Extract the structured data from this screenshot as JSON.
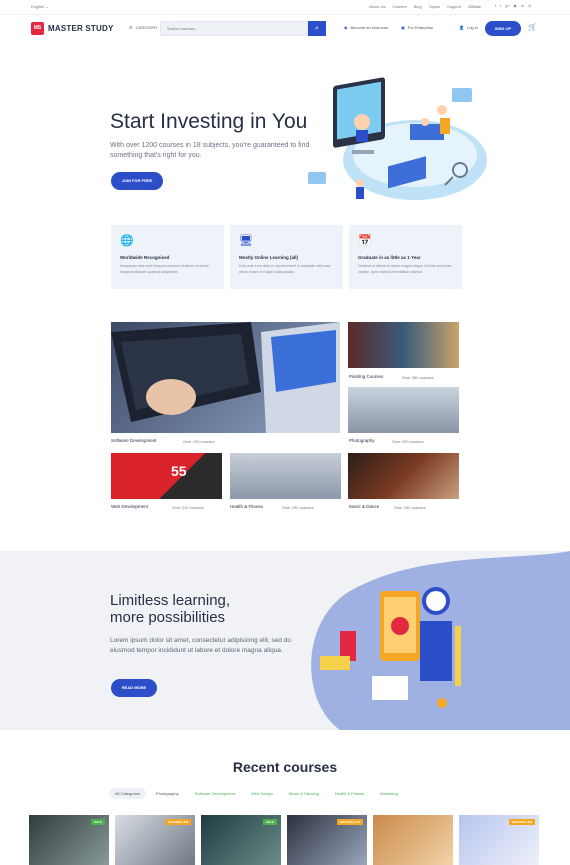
{
  "topbar": {
    "language": "English ⌄",
    "links": [
      "About Us",
      "Careers",
      "Blog",
      "Topics",
      "Support",
      "Affiliate"
    ],
    "socials": [
      "f",
      "t",
      "g+",
      "▶",
      "in",
      "◎"
    ]
  },
  "header": {
    "logo_mark": "MS",
    "logo_text": "MASTER STUDY",
    "category_label": "CATEGORY",
    "search_placeholder": "Search courses...",
    "become_instructor": "Become an Instructor",
    "for_enterprise": "For Enterprise",
    "login": "Log in",
    "signup": "SING UP"
  },
  "hero": {
    "title": "Start Investing in You",
    "subtitle": "With over 1200 courses in 18 subjects, you're guaranteed to find something that's right for you.",
    "button": "JOIN FOR FREE"
  },
  "features": [
    {
      "icon": "globe-icon",
      "glyph": "🌐",
      "title": "Worldwide Recognised",
      "text": "Nonsquam eius modi tempora incidunt ut labore et dolore magnam aliquam quaerat voluptatem."
    },
    {
      "icon": "monitor-icon",
      "glyph": "🖥",
      "title": "Mostly Online Learning (all)",
      "text": "Duis aute irure dolor in reprehenderit in voluptate velit esse cillum dolore eu fugiat nulla pariatur."
    },
    {
      "icon": "calendar-icon",
      "glyph": "📅",
      "title": "Graduate in as little as 1 Year",
      "text": "Ceddunt ut labore et dolore magna aliqua. Ut enim ad minim veniam, quis nostrud exercitation ullamco."
    }
  ],
  "categories": [
    {
      "label": "Software Development",
      "count": "Over 100 courses"
    },
    {
      "label": "Painting Courses",
      "count": "Over 350 courses"
    },
    {
      "label": "Photography",
      "count": "Over 290 courses"
    },
    {
      "label": "Web Development",
      "count": "Over 210 courses"
    },
    {
      "label": "Health & Fitness",
      "count": "Over 290 courses"
    },
    {
      "label": "Music & Dance",
      "count": "Over 150 courses"
    }
  ],
  "promo": {
    "title_line1": "Limitless learning,",
    "title_line2": "more possibilities",
    "text": "Lorem ipsum dolor sit amet, consectetur adipisicing elit, sed do eiusmod tempor incididunt ut labore et dolore magna aliqua.",
    "button": "READ MORE"
  },
  "recent": {
    "title": "Recent courses",
    "tabs": [
      "All Categories",
      "Photography",
      "Software Development",
      "Web Design",
      "Music & Dancing",
      "Health & Fitness",
      "Marketing"
    ],
    "badges": [
      "SALE",
      "BESTSELLER",
      "SALE",
      "BESTSELLER",
      "",
      "BESTSELLER"
    ]
  },
  "colors": {
    "primary": "#2c4fc9",
    "brand_red": "#e2293f",
    "tab_green": "#4caf50",
    "badge_green": "#4caf50",
    "badge_orange": "#f5a623"
  }
}
